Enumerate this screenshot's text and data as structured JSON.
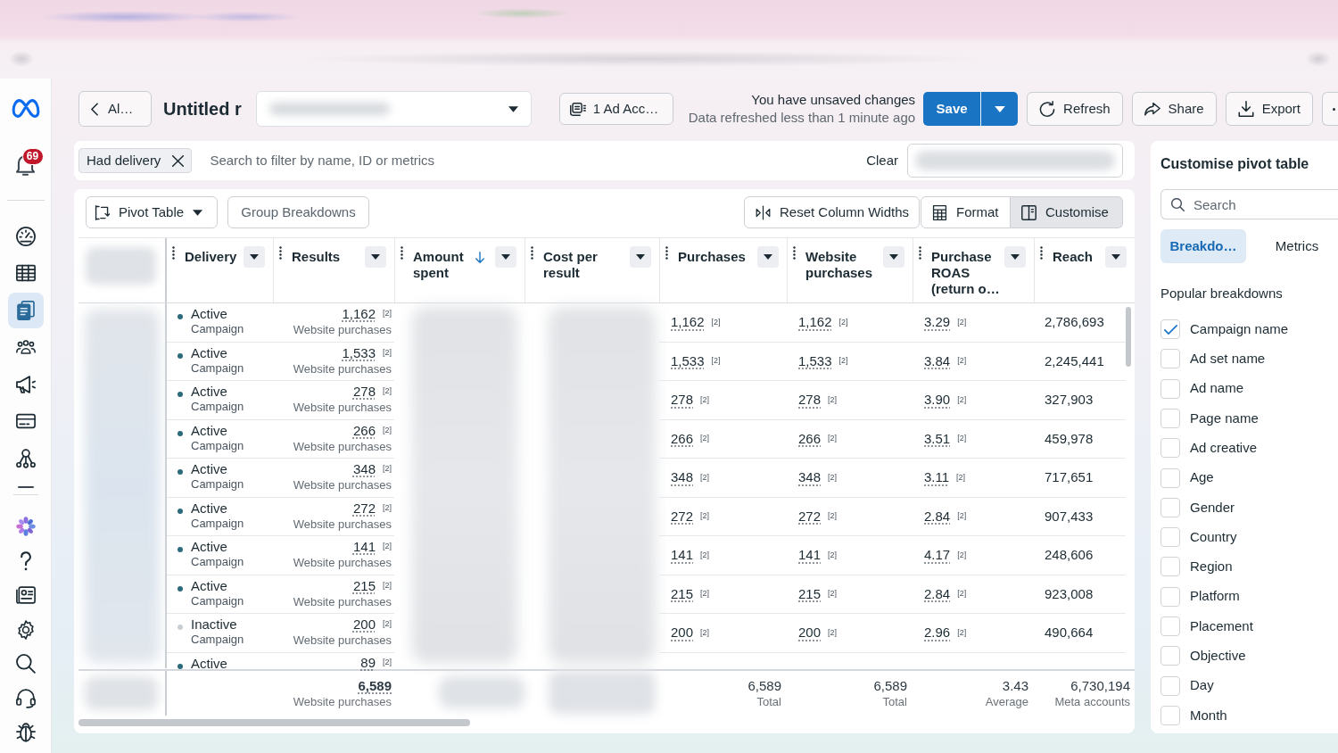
{
  "sidebar": {
    "notification_count": "69",
    "items": [
      {
        "selected": false
      },
      {
        "selected": false
      },
      {
        "selected": true
      },
      {
        "selected": false
      },
      {
        "selected": false
      },
      {
        "selected": false
      },
      {
        "selected": false
      },
      {
        "selected": false
      },
      {
        "selected": false
      },
      {
        "selected": false
      },
      {
        "selected": false
      },
      {
        "selected": false
      },
      {
        "selected": false
      },
      {
        "selected": false
      }
    ]
  },
  "header": {
    "back_button": "Al…",
    "title": "Untitled r",
    "ad_account_button": "1 Ad Acc…",
    "save_state": "You have unsaved changes",
    "refresh_state": "Data refreshed less than 1 minute ago",
    "save_button": "Save",
    "actions": [
      "Refresh",
      "Share",
      "Export"
    ]
  },
  "filter_bar": {
    "chips": [
      "Had delivery"
    ],
    "placeholder": "Search to filter by name, ID or metrics",
    "clear_button": "Clear"
  },
  "toolbar": {
    "view_button": "Pivot Table",
    "group_button": "Group Breakdowns",
    "buttons": [
      {
        "label": "Reset Column Widths",
        "selected": false
      },
      {
        "label": "Format",
        "selected": false
      },
      {
        "label": "Customise",
        "selected": true
      }
    ]
  },
  "table": {
    "columns": [
      {
        "label": "Delivery",
        "sorted": false
      },
      {
        "label": "Results",
        "sorted": false
      },
      {
        "label": "Amount spent",
        "sorted": true
      },
      {
        "label": "Cost per result",
        "sorted": false
      },
      {
        "label": "Purchases",
        "sorted": false
      },
      {
        "label": "Website purchases",
        "sorted": false
      },
      {
        "label": "Purchase ROAS (return o…",
        "sorted": false
      },
      {
        "label": "Reach",
        "sorted": false
      }
    ],
    "rows": [
      {
        "delivery": "Active",
        "color": "#2a6a7a",
        "entity": "Campaign",
        "results": {
          "value": "1,162",
          "note": "[2]",
          "label": "Website purchases"
        },
        "purchases": {
          "value": "1,162",
          "note": "[2]"
        },
        "website_purchases": {
          "value": "1,162",
          "note": "[2]"
        },
        "purchase_roas": {
          "value": "3.29",
          "note": "[2]"
        },
        "reach": "2,786,693"
      },
      {
        "delivery": "Active",
        "color": "#2a6a7a",
        "entity": "Campaign",
        "results": {
          "value": "1,533",
          "note": "[2]",
          "label": "Website purchases"
        },
        "purchases": {
          "value": "1,533",
          "note": "[2]"
        },
        "website_purchases": {
          "value": "1,533",
          "note": "[2]"
        },
        "purchase_roas": {
          "value": "3.84",
          "note": "[2]"
        },
        "reach": "2,245,441"
      },
      {
        "delivery": "Active",
        "color": "#2a6a7a",
        "entity": "Campaign",
        "results": {
          "value": "278",
          "note": "[2]",
          "label": "Website purchases"
        },
        "purchases": {
          "value": "278",
          "note": "[2]"
        },
        "website_purchases": {
          "value": "278",
          "note": "[2]"
        },
        "purchase_roas": {
          "value": "3.90",
          "note": "[2]"
        },
        "reach": "327,903"
      },
      {
        "delivery": "Active",
        "color": "#2a6a7a",
        "entity": "Campaign",
        "results": {
          "value": "266",
          "note": "[2]",
          "label": "Website purchases"
        },
        "purchases": {
          "value": "266",
          "note": "[2]"
        },
        "website_purchases": {
          "value": "266",
          "note": "[2]"
        },
        "purchase_roas": {
          "value": "3.51",
          "note": "[2]"
        },
        "reach": "459,978"
      },
      {
        "delivery": "Active",
        "color": "#2a6a7a",
        "entity": "Campaign",
        "results": {
          "value": "348",
          "note": "[2]",
          "label": "Website purchases"
        },
        "purchases": {
          "value": "348",
          "note": "[2]"
        },
        "website_purchases": {
          "value": "348",
          "note": "[2]"
        },
        "purchase_roas": {
          "value": "3.11",
          "note": "[2]"
        },
        "reach": "717,651"
      },
      {
        "delivery": "Active",
        "color": "#2a6a7a",
        "entity": "Campaign",
        "results": {
          "value": "272",
          "note": "[2]",
          "label": "Website purchases"
        },
        "purchases": {
          "value": "272",
          "note": "[2]"
        },
        "website_purchases": {
          "value": "272",
          "note": "[2]"
        },
        "purchase_roas": {
          "value": "2.84",
          "note": "[2]"
        },
        "reach": "907,433"
      },
      {
        "delivery": "Active",
        "color": "#2a6a7a",
        "entity": "Campaign",
        "results": {
          "value": "141",
          "note": "[2]",
          "label": "Website purchases"
        },
        "purchases": {
          "value": "141",
          "note": "[2]"
        },
        "website_purchases": {
          "value": "141",
          "note": "[2]"
        },
        "purchase_roas": {
          "value": "4.17",
          "note": "[2]"
        },
        "reach": "248,606"
      },
      {
        "delivery": "Active",
        "color": "#2a6a7a",
        "entity": "Campaign",
        "results": {
          "value": "215",
          "note": "[2]",
          "label": "Website purchases"
        },
        "purchases": {
          "value": "215",
          "note": "[2]"
        },
        "website_purchases": {
          "value": "215",
          "note": "[2]"
        },
        "purchase_roas": {
          "value": "2.84",
          "note": "[2]"
        },
        "reach": "923,008"
      },
      {
        "delivery": "Inactive",
        "color": "#c9ced3",
        "entity": "Campaign",
        "results": {
          "value": "200",
          "note": "[2]",
          "label": "Website purchases"
        },
        "purchases": {
          "value": "200",
          "note": "[2]"
        },
        "website_purchases": {
          "value": "200",
          "note": "[2]"
        },
        "purchase_roas": {
          "value": "2.96",
          "note": "[2]"
        },
        "reach": "490,664"
      },
      {
        "delivery": "Active",
        "color": "#2a6a7a",
        "results": {
          "value": "89",
          "note": "[2]"
        }
      }
    ],
    "totals": {
      "results": {
        "value": "6,589",
        "label": "Website purchases"
      },
      "purchases": {
        "value": "6,589",
        "label": "Total"
      },
      "website_purchases": {
        "value": "6,589",
        "label": "Total"
      },
      "purchase_roas": {
        "value": "3.43",
        "label": "Average"
      },
      "reach": {
        "value": "6,730,194",
        "label": "Meta accounts"
      }
    }
  },
  "customise_panel": {
    "title": "Customise pivot table",
    "search_placeholder": "Search",
    "tabs": [
      {
        "label": "Breakdo…",
        "selected": true
      },
      {
        "label": "Metrics",
        "selected": false
      }
    ],
    "section_title": "Popular breakdowns",
    "options": [
      {
        "label": "Campaign name",
        "checked": true
      },
      {
        "label": "Ad set name",
        "checked": false
      },
      {
        "label": "Ad name",
        "checked": false
      },
      {
        "label": "Page name",
        "checked": false
      },
      {
        "label": "Ad creative",
        "checked": false
      },
      {
        "label": "Age",
        "checked": false
      },
      {
        "label": "Gender",
        "checked": false
      },
      {
        "label": "Country",
        "checked": false
      },
      {
        "label": "Region",
        "checked": false
      },
      {
        "label": "Platform",
        "checked": false
      },
      {
        "label": "Placement",
        "checked": false
      },
      {
        "label": "Objective",
        "checked": false
      },
      {
        "label": "Day",
        "checked": false
      },
      {
        "label": "Month",
        "checked": false
      }
    ]
  }
}
